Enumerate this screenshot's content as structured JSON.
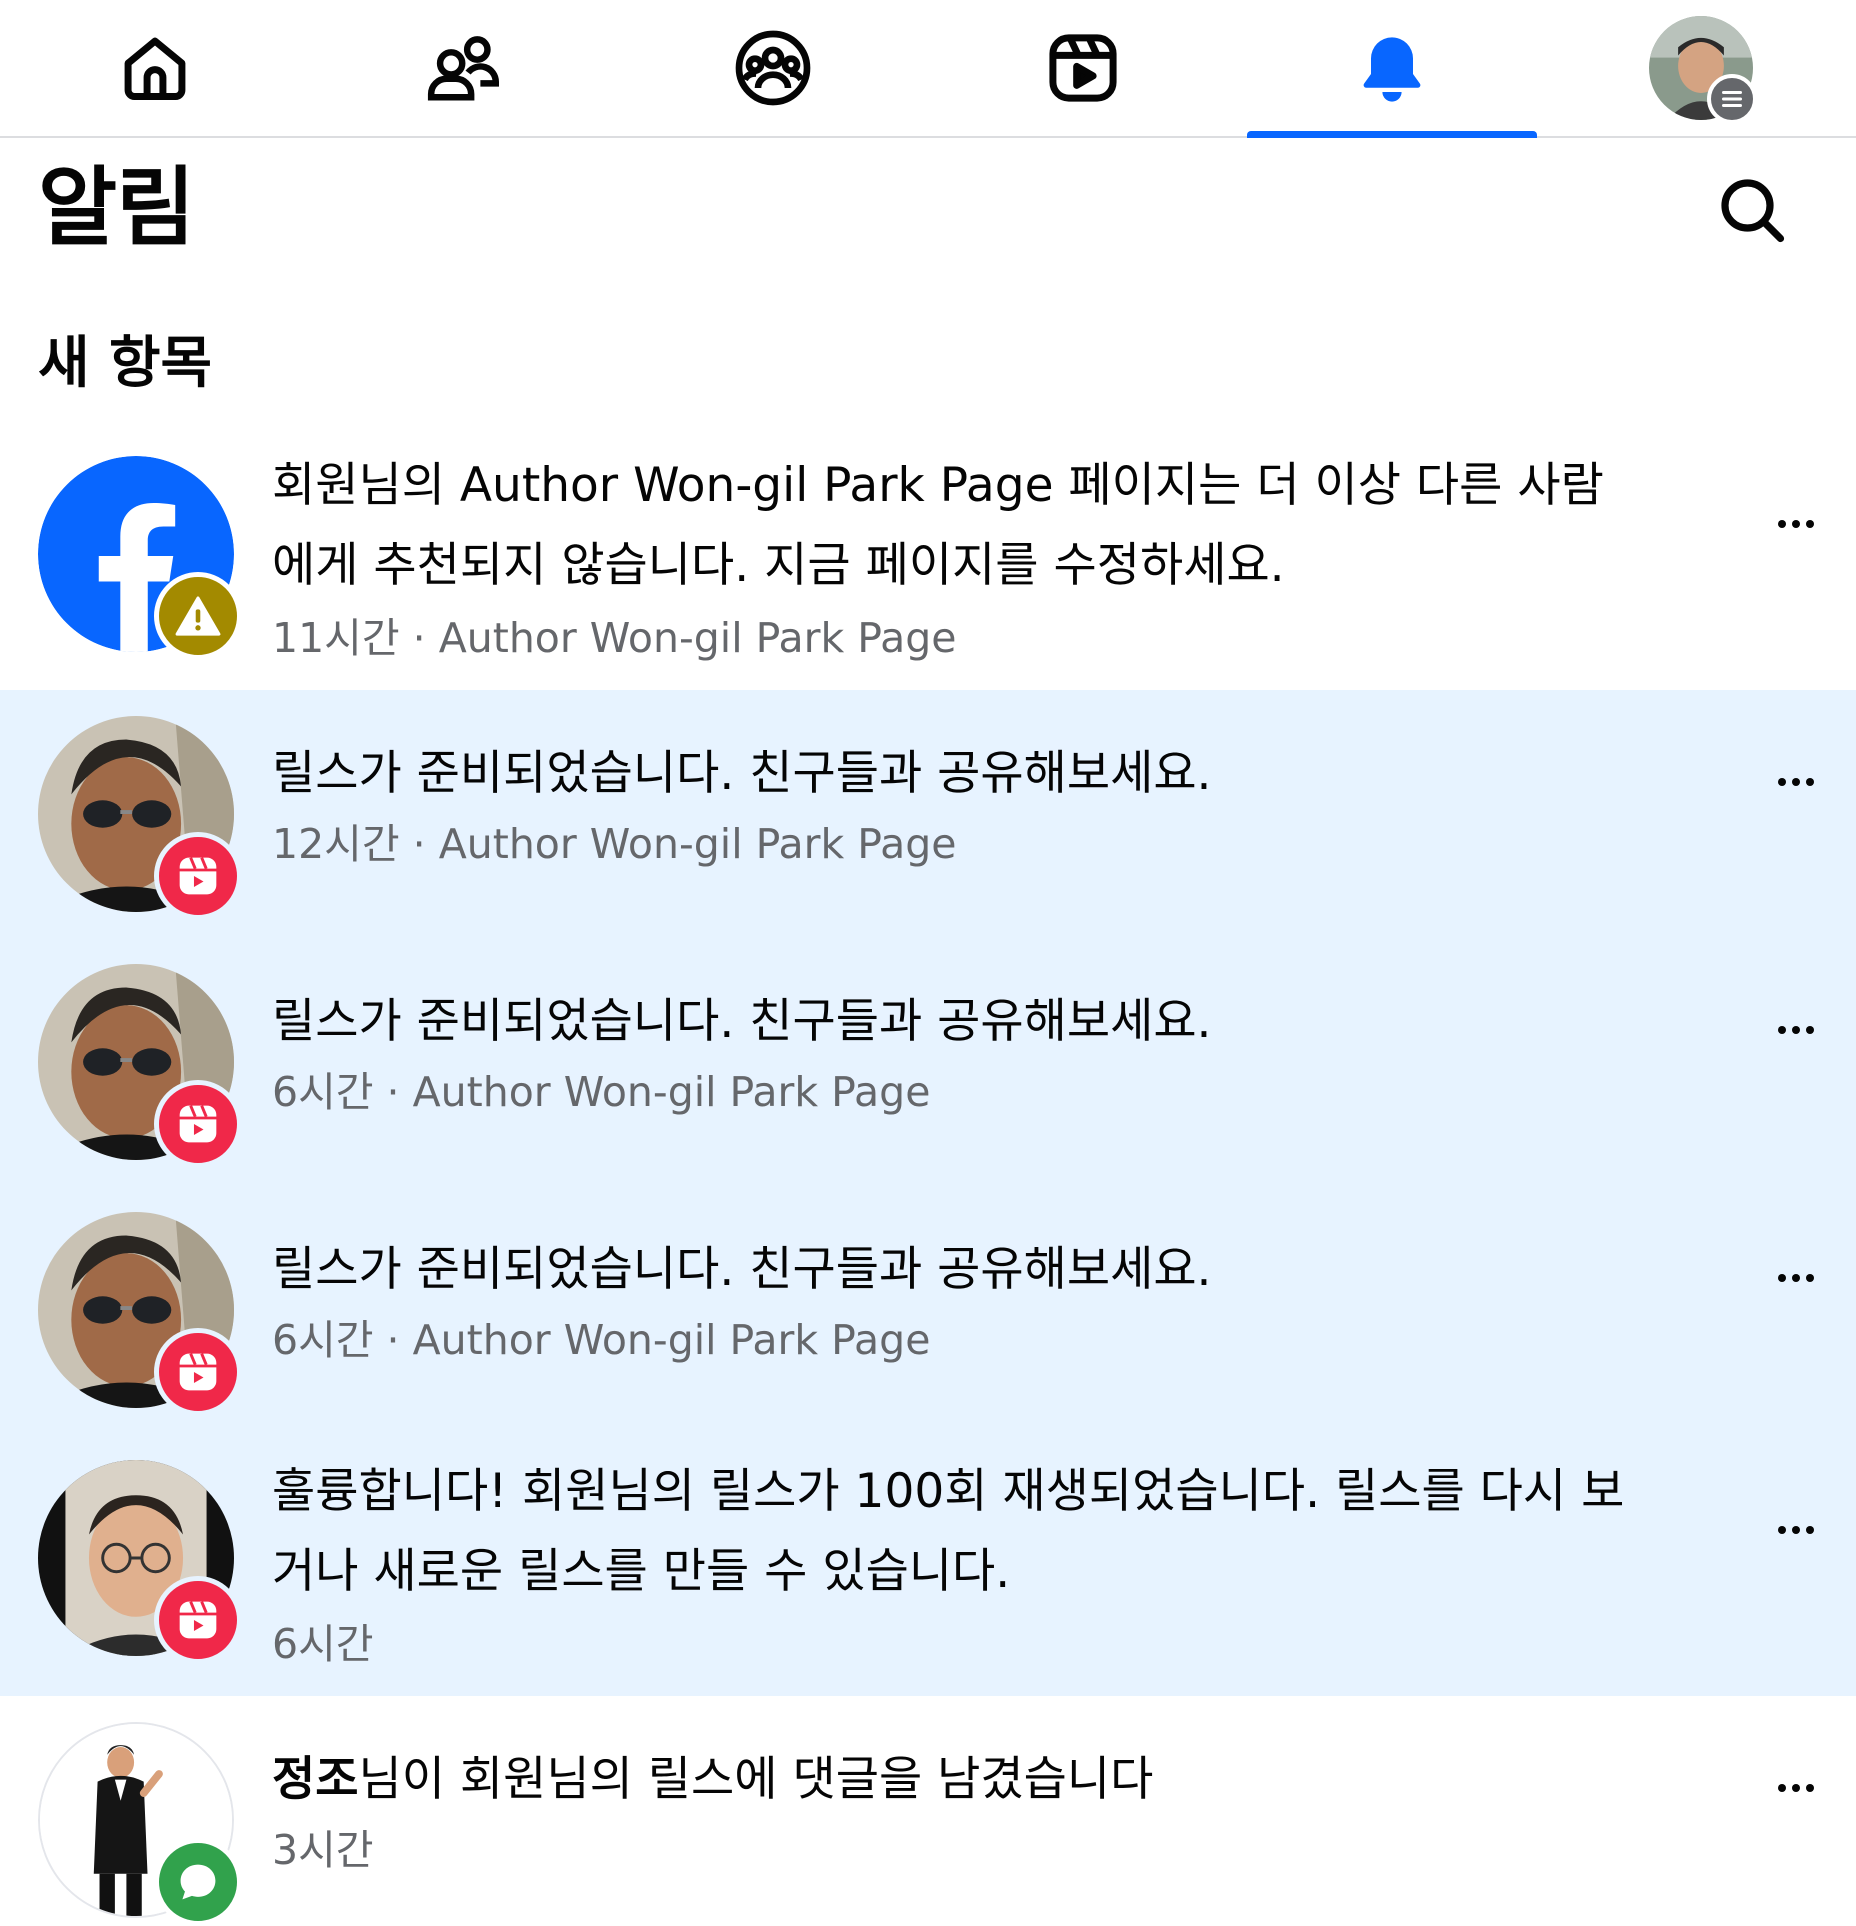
{
  "nav": {
    "tabs": [
      {
        "name": "home",
        "icon": "home-icon"
      },
      {
        "name": "friends",
        "icon": "friends-icon"
      },
      {
        "name": "groups",
        "icon": "groups-icon"
      },
      {
        "name": "reels",
        "icon": "reels-icon"
      },
      {
        "name": "notifications",
        "icon": "bell-icon",
        "active": true
      },
      {
        "name": "menu",
        "icon": "profile-menu-icon"
      }
    ],
    "active_color": "#0866ff"
  },
  "header": {
    "title": "알림",
    "search_icon": "search-icon"
  },
  "section": {
    "title": "새 항목"
  },
  "notifications": [
    {
      "text": "회원님의 Author Won-gil Park Page 페이지는 더 이상 다른 사람에게 추천되지 않습니다. 지금 페이지를 수정하세요.",
      "meta": "11시간 · Author Won-gil Park Page",
      "badge": "warning-icon",
      "avatar": "facebook-logo",
      "unread": false
    },
    {
      "text": "릴스가 준비되었습니다. 친구들과 공유해보세요.",
      "meta": "12시간 · Author Won-gil Park Page",
      "badge": "reels-icon",
      "avatar": "user-photo-sunglasses",
      "unread": true
    },
    {
      "text": "릴스가 준비되었습니다. 친구들과 공유해보세요.",
      "meta": "6시간 · Author Won-gil Park Page",
      "badge": "reels-icon",
      "avatar": "user-photo-sunglasses",
      "unread": true
    },
    {
      "text": "릴스가 준비되었습니다. 친구들과 공유해보세요.",
      "meta": "6시간 · Author Won-gil Park Page",
      "badge": "reels-icon",
      "avatar": "user-photo-sunglasses",
      "unread": true
    },
    {
      "text": "훌륭합니다! 회원님의 릴스가 100회 재생되었습니다. 릴스를 다시 보거나 새로운 릴스를 만들 수 있습니다.",
      "meta": "6시간",
      "badge": "reels-icon",
      "avatar": "user-photo-glasses",
      "unread": true
    },
    {
      "actor": "정조",
      "text": "님이 회원님의 릴스에 댓글을 남겼습니다",
      "meta": "3시간",
      "badge": "comment-icon",
      "avatar": "user-photo-tuxedo",
      "unread": false
    }
  ],
  "colors": {
    "unread_bg": "#e7f3ff",
    "reel_badge": "#f02849",
    "warn_badge": "#a38a00",
    "comment_badge": "#31a24c",
    "facebook_blue": "#0866ff"
  }
}
